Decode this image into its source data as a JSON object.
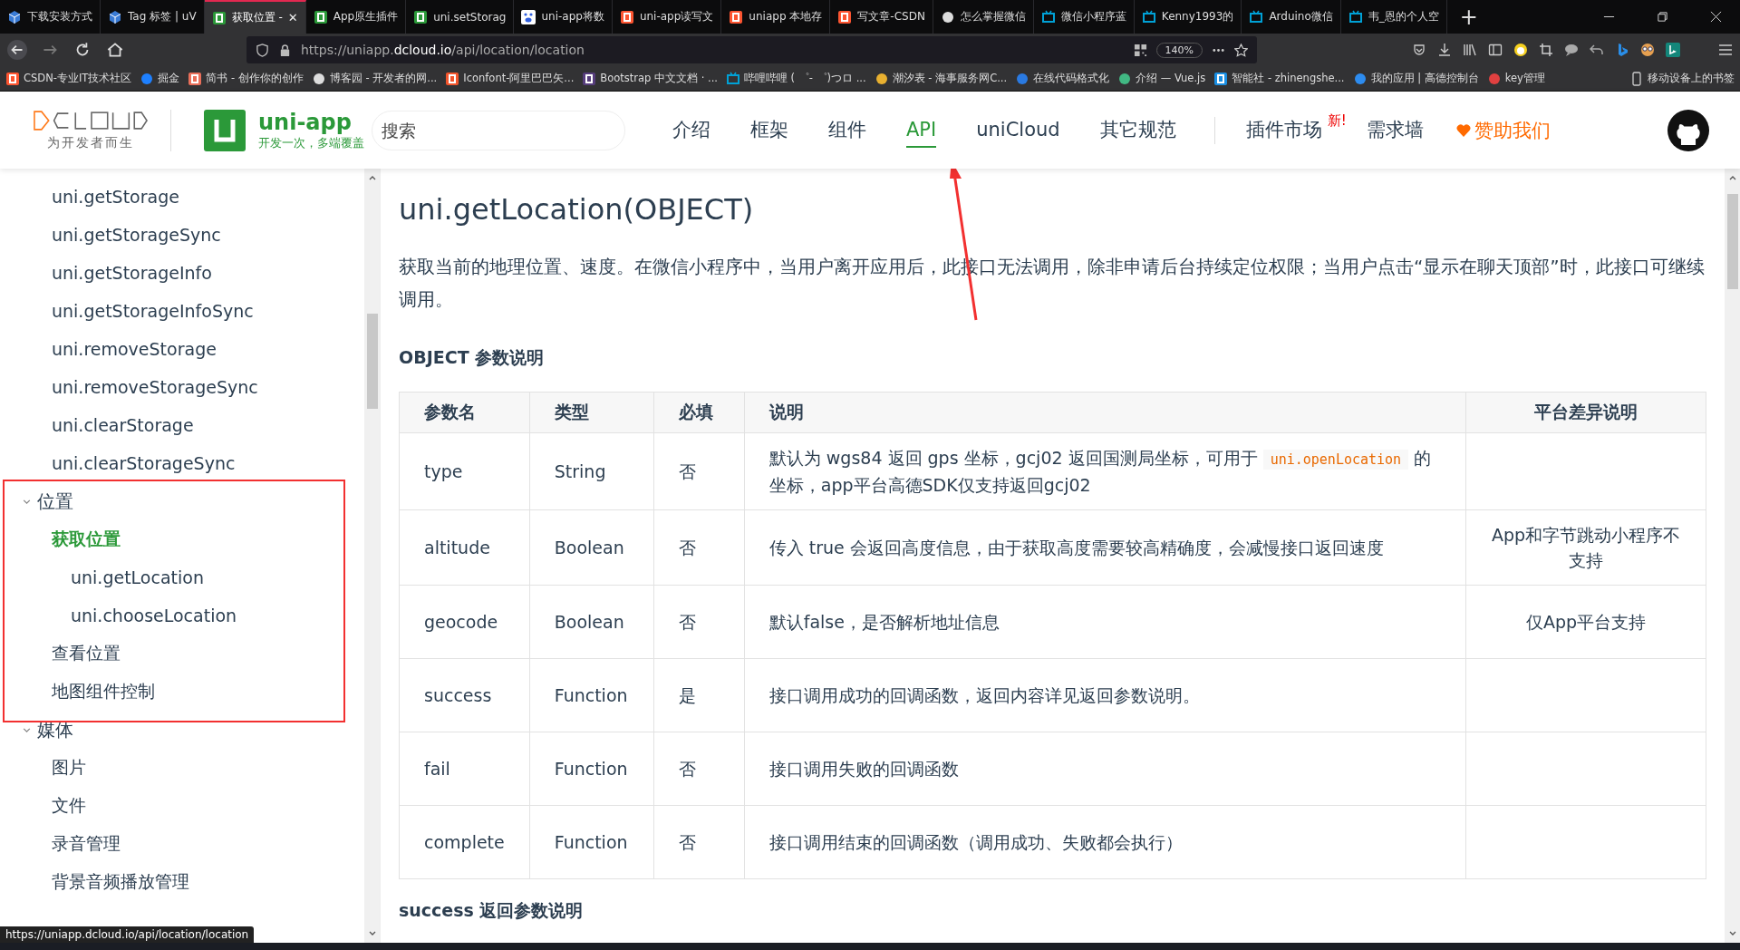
{
  "browser": {
    "tabs": [
      {
        "kind": "shield",
        "title": "下载安装方式",
        "selected": false
      },
      {
        "kind": "shield",
        "title": "Tag 标签 | uV",
        "selected": false
      },
      {
        "kind": "uni",
        "title": "获取位置 -",
        "selected": true,
        "close": "✕"
      },
      {
        "kind": "uni",
        "title": "App原生插件",
        "selected": false
      },
      {
        "kind": "uni",
        "title": "uni.setStorag",
        "selected": false
      },
      {
        "kind": "paw",
        "title": "uni-app将数",
        "selected": false
      },
      {
        "kind": "csdn",
        "title": "uni-app读写文",
        "selected": false
      },
      {
        "kind": "csdn",
        "title": "uniapp 本地存",
        "selected": false
      },
      {
        "kind": "csdn",
        "title": "写文章-CSDN",
        "selected": false
      },
      {
        "kind": "swirl",
        "title": "怎么掌握微信",
        "selected": false
      },
      {
        "kind": "tv",
        "title": "微信小程序蓝",
        "selected": false
      },
      {
        "kind": "tv",
        "title": "Kenny1993的",
        "selected": false
      },
      {
        "kind": "tv",
        "title": "Arduino微信",
        "selected": false
      },
      {
        "kind": "tv",
        "title": "韦_恩的个人空",
        "selected": false
      }
    ],
    "new_tab": "+",
    "url": {
      "prefix": "https://uniapp.",
      "domain": "dcloud.io",
      "path": "/api/location/location"
    },
    "zoom": "140%",
    "bookmarks": [
      {
        "kind": "csdn",
        "label": "CSDN-专业IT技术社区"
      },
      {
        "kind": "juejin",
        "label": "掘金"
      },
      {
        "kind": "jianshu",
        "label": "简书 - 创作你的创作"
      },
      {
        "kind": "swirl",
        "label": "博客园 - 开发者的网..."
      },
      {
        "kind": "iconfont",
        "label": "Iconfont-阿里巴巴矢..."
      },
      {
        "kind": "bootstrap",
        "label": "Bootstrap 中文文档 · ..."
      },
      {
        "kind": "tv",
        "label": "哔哩哔哩 ( ゜- ゜)つロ ..."
      },
      {
        "kind": "wave",
        "label": "潮汐表 - 海事服务网C..."
      },
      {
        "kind": "ring",
        "label": "在线代码格式化"
      },
      {
        "kind": "vue",
        "label": "介绍 — Vue.js"
      },
      {
        "kind": "zhi",
        "label": "智能社 - zhinengshe..."
      },
      {
        "kind": "plane",
        "label": "我的应用 | 高德控制台"
      },
      {
        "kind": "compass",
        "label": "key管理"
      }
    ],
    "mobile_bookmarks": "移动设备上的书签"
  },
  "header": {
    "brand_tagline": "为开发者而生",
    "app_name": "uni-app",
    "app_slogan": "开发一次，多端覆盖",
    "search": {
      "placeholder": "搜索"
    },
    "nav": [
      {
        "label": "介绍",
        "selected": false
      },
      {
        "label": "框架",
        "selected": false
      },
      {
        "label": "组件",
        "selected": false
      },
      {
        "label": "API",
        "selected": true
      },
      {
        "label": "uniCloud",
        "selected": false
      },
      {
        "label": "其它规范",
        "selected": false
      }
    ],
    "plugin_market": "插件市场",
    "new_badge": "新!",
    "wishes": "需求墙",
    "sponsor": "赞助我们"
  },
  "sidebar": {
    "items": [
      {
        "kind": "link",
        "label": "uni.getStorage",
        "selected": false
      },
      {
        "kind": "link",
        "label": "uni.getStorageSync",
        "selected": false
      },
      {
        "kind": "link",
        "label": "uni.getStorageInfo",
        "selected": false
      },
      {
        "kind": "link",
        "label": "uni.getStorageInfoSync",
        "selected": false
      },
      {
        "kind": "link",
        "label": "uni.removeStorage",
        "selected": false
      },
      {
        "kind": "link",
        "label": "uni.removeStorageSync",
        "selected": false
      },
      {
        "kind": "link",
        "label": "uni.clearStorage",
        "selected": false
      },
      {
        "kind": "link",
        "label": "uni.clearStorageSync",
        "selected": false
      },
      {
        "kind": "group",
        "label": "位置",
        "expanded": true,
        "children": [
          {
            "kind": "link",
            "label": "获取位置",
            "selected": true,
            "children": [
              {
                "kind": "link",
                "label": "uni.getLocation",
                "selected": false
              },
              {
                "kind": "link",
                "label": "uni.chooseLocation",
                "selected": false
              }
            ]
          },
          {
            "kind": "link",
            "label": "查看位置",
            "selected": false
          },
          {
            "kind": "link",
            "label": "地图组件控制",
            "selected": false
          }
        ]
      },
      {
        "kind": "group",
        "label": "媒体",
        "expanded": true,
        "children": [
          {
            "kind": "link",
            "label": "图片",
            "selected": false
          },
          {
            "kind": "link",
            "label": "文件",
            "selected": false
          },
          {
            "kind": "link",
            "label": "录音管理",
            "selected": false
          },
          {
            "kind": "link",
            "label": "背景音频播放管理",
            "selected": false
          }
        ]
      }
    ]
  },
  "content": {
    "title": "uni.getLocation(OBJECT)",
    "intro": "获取当前的地理位置、速度。在微信小程序中，当用户离开应用后，此接口无法调用，除非申请后台持续定位权限；当用户点击“显示在聊天顶部”时，此接口可继续调用。",
    "section_title": "OBJECT 参数说明",
    "table": {
      "columns": [
        "参数名",
        "类型",
        "必填",
        "说明",
        "平台差异说明"
      ],
      "rows": [
        {
          "name": "type",
          "type": "String",
          "required": "否",
          "description": [
            {
              "kind": "text",
              "text": "默认为 wgs84 返回 gps 坐标，gcj02 返回国测局坐标，可用于 "
            },
            {
              "kind": "code",
              "text": "uni.openLocation"
            },
            {
              "kind": "text",
              "text": " 的坐标，app平台高德SDK仅支持返回gcj02"
            }
          ]
        },
        {
          "name": "altitude",
          "type": "Boolean",
          "required": "否",
          "description": [
            {
              "kind": "text",
              "text": "传入 true 会返回高度信息，由于获取高度需要较高精确度，会减慢接口返回速度"
            }
          ],
          "platform": "App和字节跳动小程序不支持"
        },
        {
          "name": "geocode",
          "type": "Boolean",
          "required": "否",
          "description": [
            {
              "kind": "text",
              "text": "默认false，是否解析地址信息"
            }
          ],
          "platform": "仅App平台支持"
        },
        {
          "name": "success",
          "type": "Function",
          "required": "是",
          "description": [
            {
              "kind": "text",
              "text": "接口调用成功的回调函数，返回内容详见返回参数说明。"
            }
          ]
        },
        {
          "name": "fail",
          "type": "Function",
          "required": "否",
          "description": [
            {
              "kind": "text",
              "text": "接口调用失败的回调函数"
            }
          ]
        },
        {
          "name": "complete",
          "type": "Function",
          "required": "否",
          "description": [
            {
              "kind": "text",
              "text": "接口调用结束的回调函数（调用成功、失败都会执行）"
            }
          ]
        }
      ]
    },
    "next_section_title": "success 返回参数说明"
  },
  "status_bar": {
    "link_preview": "https://uniapp.dcloud.io/api/location/location"
  }
}
